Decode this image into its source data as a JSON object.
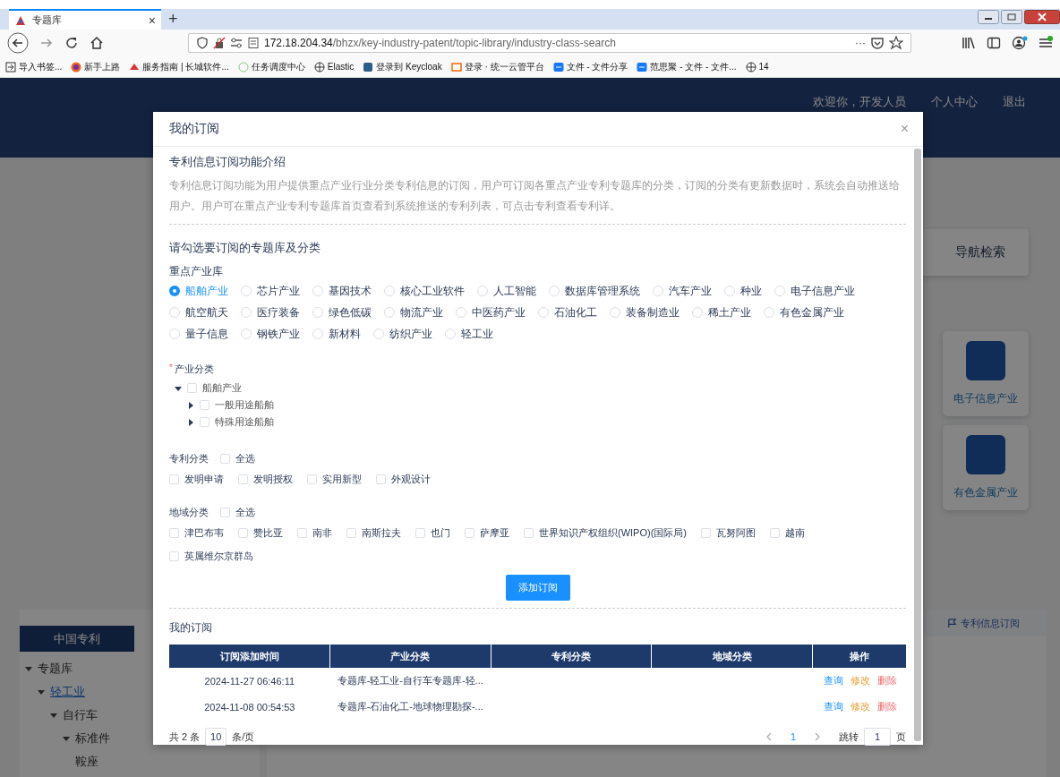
{
  "browser": {
    "tab": {
      "title": "专题库",
      "close": "×",
      "new_tab": "+"
    },
    "address": {
      "host": "172.18.204.34",
      "path": "/bhzx/key-industry-patent/topic-library/industry-class-search",
      "more": "···"
    },
    "bookmarks": [
      {
        "label": "导入书签..."
      },
      {
        "label": "新手上路"
      },
      {
        "label": "服务指南 | 长城软件..."
      },
      {
        "label": "任务调度中心"
      },
      {
        "label": "Elastic"
      },
      {
        "label": "登录到 Keycloak"
      },
      {
        "label": "登录 · 统一云管平台"
      },
      {
        "label": "文件 - 文件分享"
      },
      {
        "label": "范思聚 - 文件 - 文件..."
      },
      {
        "label": "14"
      }
    ]
  },
  "header": {
    "welcome": "欢迎你，开发人员",
    "links": [
      "个人中心",
      "退出"
    ]
  },
  "sidebar": {
    "tab": "中国专利",
    "tree": [
      {
        "label": "专题库",
        "expanded": true,
        "selected": false,
        "children": [
          {
            "label": "轻工业",
            "expanded": true,
            "selected": true,
            "children": [
              {
                "label": "自行车",
                "expanded": true,
                "selected": false,
                "children": [
                  {
                    "label": "标准件",
                    "expanded": true,
                    "selected": false,
                    "children": [
                      {
                        "label": "鞍座",
                        "selected": false
                      }
                    ]
                  }
                ]
              }
            ]
          }
        ]
      }
    ]
  },
  "cards": [
    {
      "label": "导航检索",
      "kind": "wide"
    },
    {
      "label": "电子信息产业",
      "kind": "image"
    },
    {
      "label": "有色金属产业",
      "kind": "image"
    }
  ],
  "subscribe_link": "专利信息订阅",
  "modal": {
    "title": "我的订阅",
    "close": "×",
    "intro": {
      "heading": "专利信息订阅功能介绍",
      "text": "专利信息订阅功能为用户提供重点产业行业分类专利信息的订阅，用户可订阅各重点产业专利专题库的分类，订阅的分类有更新数据时，系统会自动推送给用户。用户可在重点产业专利专题库首页查看到系统推送的专利列表，可点击专利查看专利详。"
    },
    "form": {
      "heading": "请勾选要订阅的专题库及分类",
      "library": {
        "label": "重点产业库",
        "options": [
          {
            "label": "船舶产业",
            "selected": true
          },
          {
            "label": "芯片产业",
            "selected": false
          },
          {
            "label": "基因技术",
            "selected": false
          },
          {
            "label": "核心工业软件",
            "selected": false
          },
          {
            "label": "人工智能",
            "selected": false
          },
          {
            "label": "数据库管理系统",
            "selected": false
          },
          {
            "label": "汽车产业",
            "selected": false
          },
          {
            "label": "种业",
            "selected": false
          },
          {
            "label": "电子信息产业",
            "selected": false
          },
          {
            "label": "航空航天",
            "selected": false
          },
          {
            "label": "医疗装备",
            "selected": false
          },
          {
            "label": "绿色低碳",
            "selected": false
          },
          {
            "label": "物流产业",
            "selected": false
          },
          {
            "label": "中医药产业",
            "selected": false
          },
          {
            "label": "石油化工",
            "selected": false
          },
          {
            "label": "装备制造业",
            "selected": false
          },
          {
            "label": "稀土产业",
            "selected": false
          },
          {
            "label": "有色金属产业",
            "selected": false
          },
          {
            "label": "量子信息",
            "selected": false
          },
          {
            "label": "钢铁产业",
            "selected": false
          },
          {
            "label": "新材料",
            "selected": false
          },
          {
            "label": "纺织产业",
            "selected": false
          },
          {
            "label": "轻工业",
            "selected": false
          }
        ]
      },
      "industry": {
        "label": "产业分类",
        "required_mark": "*",
        "tree": [
          {
            "label": "船舶产业",
            "expanded": true,
            "checked": false,
            "children": [
              {
                "label": "一般用途船舶",
                "expanded": false,
                "checked": false
              },
              {
                "label": "特殊用途船舶",
                "expanded": false,
                "checked": false
              }
            ]
          }
        ]
      },
      "patent_types": {
        "label": "专利分类",
        "select_all": {
          "label": "全选",
          "checked": false
        },
        "options": [
          {
            "label": "发明申请",
            "checked": false
          },
          {
            "label": "发明授权",
            "checked": false
          },
          {
            "label": "实用新型",
            "checked": false
          },
          {
            "label": "外观设计",
            "checked": false
          }
        ]
      },
      "regions": {
        "label": "地域分类",
        "select_all": {
          "label": "全选",
          "checked": false
        },
        "options": [
          {
            "label": "津巴布韦",
            "checked": false
          },
          {
            "label": "赞比亚",
            "checked": false
          },
          {
            "label": "南非",
            "checked": false
          },
          {
            "label": "南斯拉夫",
            "checked": false
          },
          {
            "label": "也门",
            "checked": false
          },
          {
            "label": "萨摩亚",
            "checked": false
          },
          {
            "label": "世界知识产权组织(WIPO)(国际局)",
            "checked": false
          },
          {
            "label": "瓦努阿图",
            "checked": false
          },
          {
            "label": "越南",
            "checked": false
          },
          {
            "label": "英属维尔京群岛",
            "checked": false
          }
        ]
      },
      "submit": "添加订阅"
    },
    "subscriptions": {
      "heading": "我的订阅",
      "columns": [
        "订阅添加时间",
        "产业分类",
        "专利分类",
        "地域分类",
        "操作"
      ],
      "rows": [
        {
          "cells": [
            "2024-11-27 06:46:11",
            "专题库-轻工业-自行车专题库-轻..."
          ],
          "actions": [
            {
              "label": "查询",
              "kind": "view"
            },
            {
              "label": "修改",
              "kind": "edit"
            },
            {
              "label": "删除",
              "kind": "delete"
            }
          ]
        },
        {
          "cells": [
            "2024-11-08 00:54:53",
            "专题库-石油化工-地球物理勘探-..."
          ],
          "actions": [
            {
              "label": "查询",
              "kind": "view"
            },
            {
              "label": "修改",
              "kind": "edit"
            },
            {
              "label": "删除",
              "kind": "delete"
            }
          ]
        }
      ],
      "pagination": {
        "total": "共 2 条",
        "page_size": "10",
        "page_size_unit": "条/页",
        "pages": [
          {
            "label": "1",
            "selected": true
          }
        ],
        "jump_label": "跳转",
        "jump_value": "1",
        "jump_unit": "页"
      }
    }
  }
}
